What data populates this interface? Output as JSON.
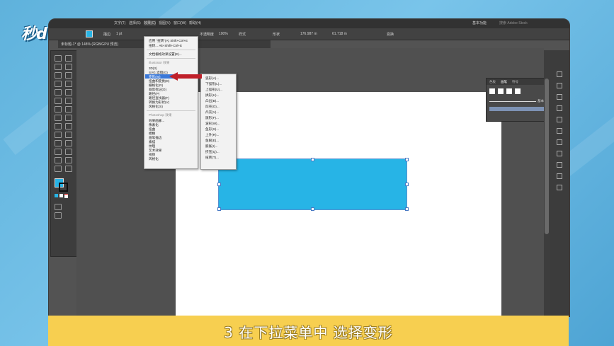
{
  "logo": "秒d•ng视频",
  "menubar": {
    "items": [
      "文字(T)",
      "选择(S)",
      "效果(C)",
      "视图(V)",
      "窗口(W)",
      "帮助(H)"
    ],
    "workspace": "基本功能",
    "search_placeholder": "搜索 Adobe Stock"
  },
  "control_bar": {
    "stroke_label": "描边",
    "stroke_value": "1 pt",
    "opacity_label": "不透明度",
    "opacity_value": "100%",
    "style_label": "样式",
    "shape_label": "形状",
    "width_value": "176.987 m",
    "height_value": "61.718 m",
    "transform_label": "变换"
  },
  "document_tab": "未标题-1* @ 148% (RGB/GPU 预览)",
  "effect_menu": {
    "top_items": [
      {
        "label": "应用 \"扭转\"(A)",
        "shortcut": "Shift+Ctrl+E"
      },
      {
        "label": "扭转...",
        "shortcut": "Alt+Shift+Ctrl+E"
      }
    ],
    "doc_raster": "文档栅格效果设置(E)...",
    "illustrator_header": "Illustrator 效果",
    "illustrator_items": [
      "3D(3)",
      "SVG 滤镜(G)",
      "变形(W)",
      "扭曲和变换(D)",
      "栅格化(R)",
      "裁剪标记(O)",
      "路径(P)",
      "路径查找器(F)",
      "转换为形状(V)",
      "风格化(S)"
    ],
    "photoshop_header": "Photoshop 效果",
    "photoshop_items": [
      "效果画廊...",
      "像素化",
      "扭曲",
      "模糊",
      "画笔描边",
      "素描",
      "纹理",
      "艺术效果",
      "视频",
      "风格化"
    ]
  },
  "warp_submenu": {
    "items": [
      "弧形(A)...",
      "下弧形(L)...",
      "上弧形(U)...",
      "拱形(H)...",
      "凸出(B)...",
      "凹壳(O)...",
      "凸壳(V)...",
      "旗形(F)...",
      "波形(W)...",
      "鱼形(S)...",
      "上升(R)...",
      "鱼眼(E)...",
      "膨胀(I)...",
      "挤压(Q)...",
      "扭转(T)..."
    ]
  },
  "stroke_panel": {
    "tabs": [
      "色板",
      "画笔",
      "符号"
    ],
    "value": "基本"
  },
  "selected_item": "变形(W)",
  "colors": {
    "shape_fill": "#27b4e6",
    "caption_bg": "#f7cf50",
    "menu_highlight": "#3a78d8",
    "arrow": "#c0202a"
  },
  "caption": "3 在下拉菜单中 选择变形"
}
